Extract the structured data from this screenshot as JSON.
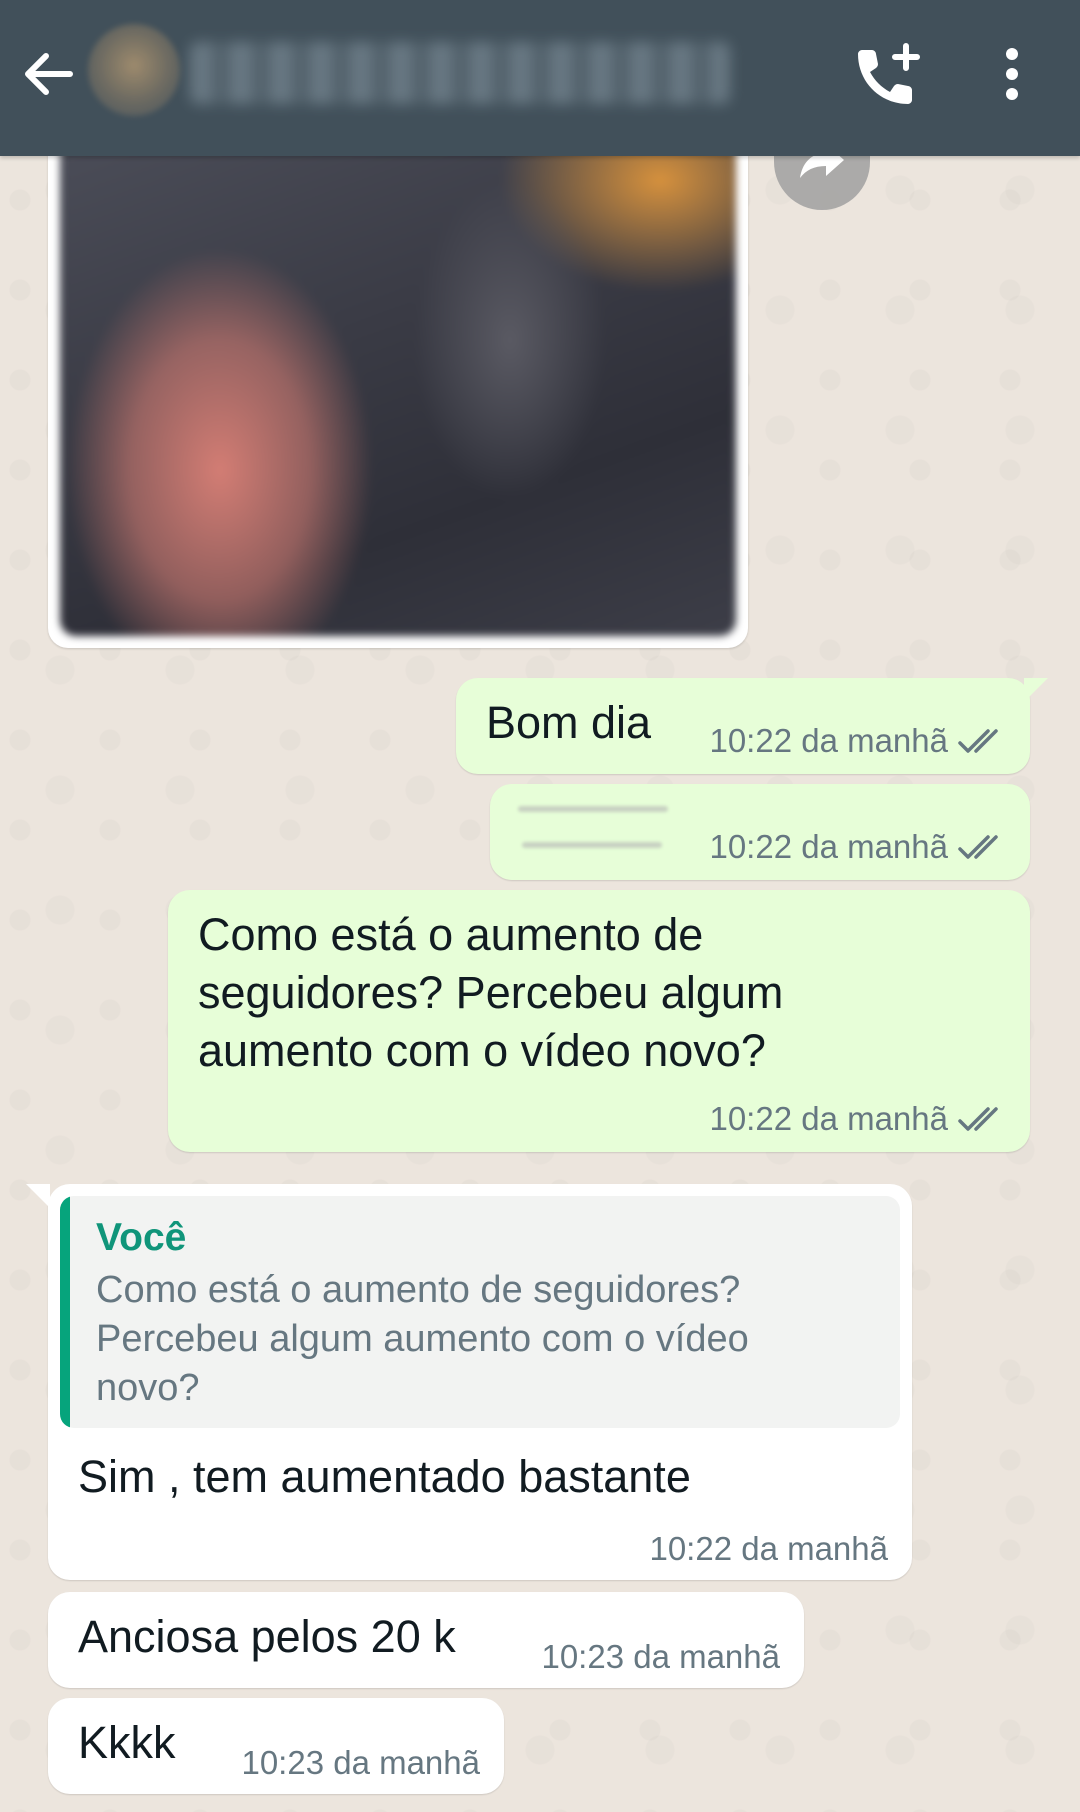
{
  "colors": {
    "header_bg": "#41505a",
    "outgoing_bubble": "#e7fed8",
    "incoming_bubble": "#ffffff",
    "quote_accent": "#06a47c",
    "read_ticks": "#667781"
  },
  "header": {
    "back_icon": "arrow-left-icon",
    "call_icon": "phone-plus-icon",
    "menu_icon": "more-vertical-icon"
  },
  "messages": [
    {
      "type": "image",
      "direction": "in"
    },
    {
      "type": "text",
      "direction": "out",
      "text": "Bom dia",
      "time": "10:22 da manhã",
      "status": "read"
    },
    {
      "type": "redacted",
      "direction": "out",
      "time": "10:22 da manhã",
      "status": "read"
    },
    {
      "type": "text",
      "direction": "out",
      "text": "Como está o aumento de seguidores? Percebeu algum aumento com o vídeo novo?",
      "time": "10:22 da manhã",
      "status": "read"
    },
    {
      "type": "reply",
      "direction": "in",
      "quote": {
        "author": "Você",
        "text": "Como está o aumento de seguidores? Percebeu algum aumento com o vídeo novo?"
      },
      "text": "Sim , tem aumentado bastante",
      "time": "10:22 da manhã"
    },
    {
      "type": "text",
      "direction": "in",
      "text": "Anciosa pelos 20 k",
      "time": "10:23 da manhã"
    },
    {
      "type": "text",
      "direction": "in",
      "text": "Kkkk",
      "time": "10:23 da manhã"
    }
  ]
}
